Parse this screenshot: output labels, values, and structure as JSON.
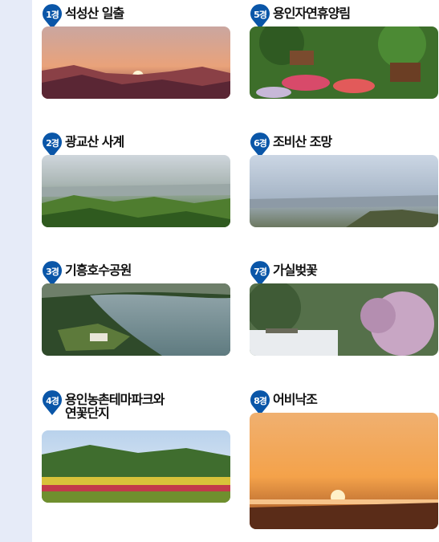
{
  "items": [
    {
      "num": "1경",
      "title": "석성산 일출"
    },
    {
      "num": "2경",
      "title": "광교산 사계"
    },
    {
      "num": "3경",
      "title": "기흥호수공원"
    },
    {
      "num": "4경",
      "title_line1": "용인농촌테마파크와",
      "title_line2": "연꽃단지"
    },
    {
      "num": "5경",
      "title": "용인자연휴양림"
    },
    {
      "num": "6경",
      "title": "조비산 조망"
    },
    {
      "num": "7경",
      "title": "가실벚꽃"
    },
    {
      "num": "8경",
      "title": "어비낙조"
    }
  ],
  "colors": {
    "badge": "#0a56a8",
    "sidebar": "#e6ebf8"
  }
}
